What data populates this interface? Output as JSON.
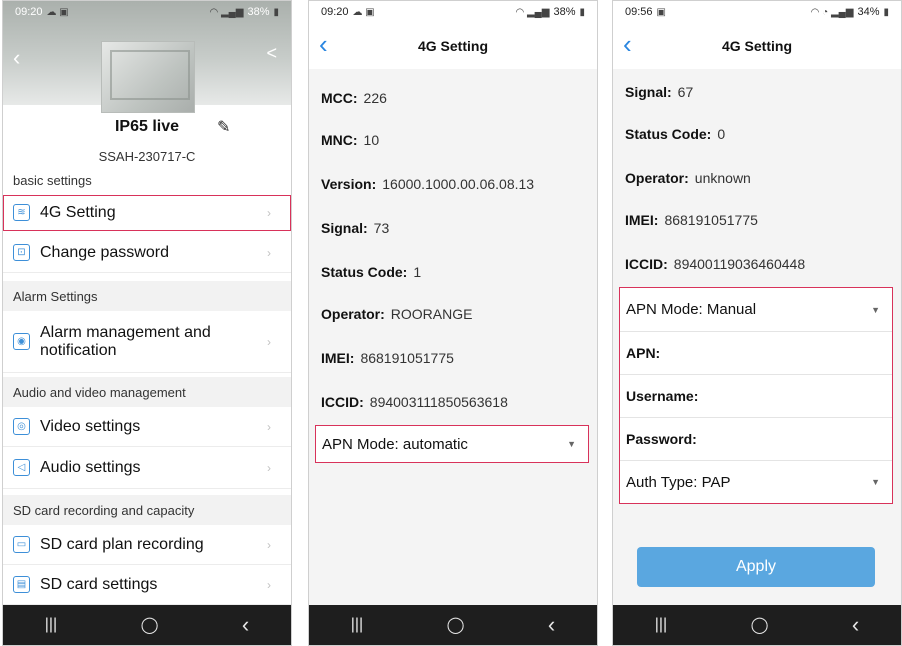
{
  "phone1": {
    "status": {
      "time": "09:20",
      "battery": "38%"
    },
    "device_name": "IP65 live",
    "serial": "SSAH-230717-C",
    "sections": [
      {
        "heading": "basic settings",
        "items": [
          {
            "label": "4G Setting",
            "icon": "wifi-icon"
          },
          {
            "label": "Change password",
            "icon": "lock-icon"
          }
        ]
      },
      {
        "heading": "Alarm Settings",
        "items": [
          {
            "label": "Alarm management and notification",
            "icon": "alarm-icon"
          }
        ]
      },
      {
        "heading": "Audio and video management",
        "items": [
          {
            "label": "Video settings",
            "icon": "camera-icon"
          },
          {
            "label": "Audio settings",
            "icon": "speaker-icon"
          }
        ]
      },
      {
        "heading": "SD card recording and capacity",
        "items": [
          {
            "label": "SD card plan recording",
            "icon": "record-icon"
          },
          {
            "label": "SD card settings",
            "icon": "sdcard-icon"
          }
        ]
      }
    ]
  },
  "phone2": {
    "status": {
      "time": "09:20",
      "battery": "38%"
    },
    "title": "4G Setting",
    "fields": [
      {
        "key": "MCC:",
        "value": "226"
      },
      {
        "key": "MNC:",
        "value": "10"
      },
      {
        "key": "Version:",
        "value": "16000.1000.00.06.08.13"
      },
      {
        "key": "Signal:",
        "value": "73"
      },
      {
        "key": "Status Code:",
        "value": "1"
      },
      {
        "key": "Operator:",
        "value": "ROORANGE"
      },
      {
        "key": "IMEI:",
        "value": "868191051775"
      },
      {
        "key": "ICCID:",
        "value": "894003111850563618"
      }
    ],
    "apn_mode_label": "APN Mode:",
    "apn_mode_value": "automatic"
  },
  "phone3": {
    "status": {
      "time": "09:56",
      "battery": "34%"
    },
    "title": "4G Setting",
    "fields": [
      {
        "key": "Signal:",
        "value": "67"
      },
      {
        "key": "Status Code:",
        "value": "0"
      },
      {
        "key": "Operator:",
        "value": "unknown"
      },
      {
        "key": "IMEI:",
        "value": "868191051775"
      },
      {
        "key": "ICCID:",
        "value": "89400119036460448"
      }
    ],
    "apn_mode_label": "APN Mode:",
    "apn_mode_value": "Manual",
    "apn_label": "APN:",
    "username_label": "Username:",
    "password_label": "Password:",
    "auth_type_label": "Auth Type:",
    "auth_type_value": "PAP",
    "apply_label": "Apply"
  },
  "navbar": {
    "recents": "|||",
    "home": "◯",
    "back": "‹"
  },
  "colors": {
    "accent": "#2a86e0",
    "highlight": "#d8325a",
    "apply": "#5aa7e0"
  }
}
